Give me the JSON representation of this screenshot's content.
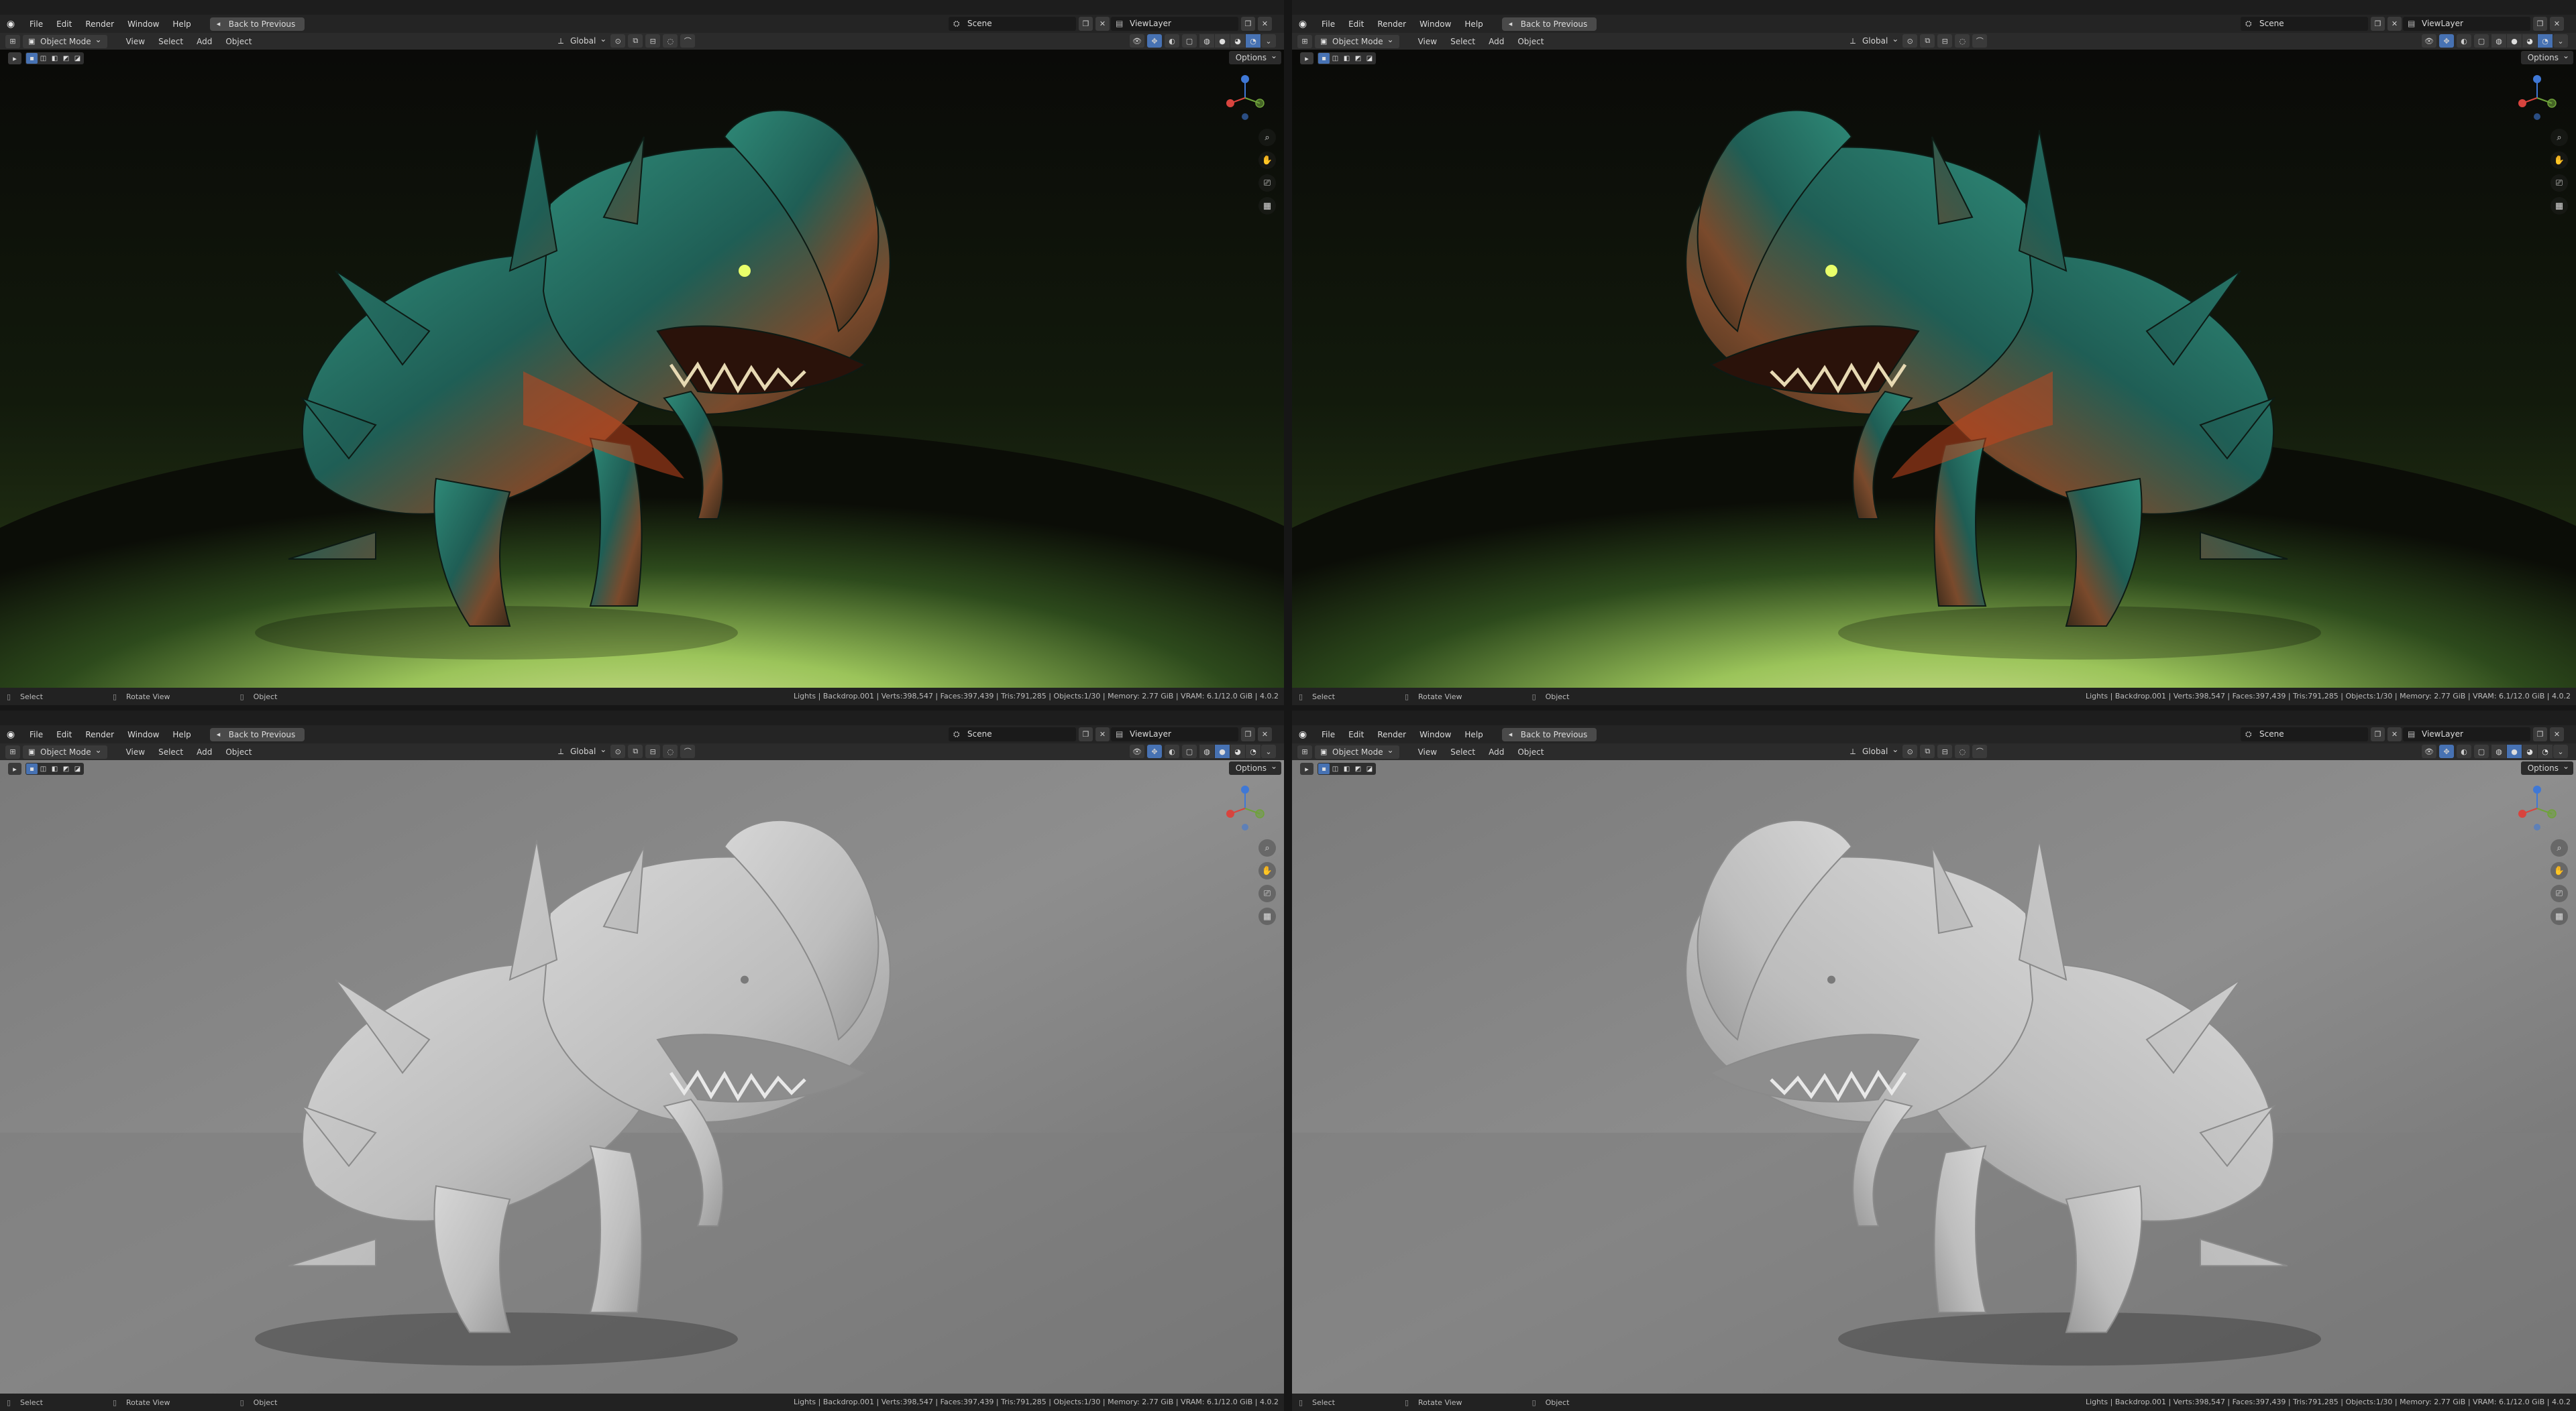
{
  "app": {
    "menus": [
      "File",
      "Edit",
      "Render",
      "Window",
      "Help"
    ],
    "back_label": "Back to Previous",
    "scene_label": "Scene",
    "view_layer_label": "ViewLayer"
  },
  "header": {
    "mode_label": "Object Mode",
    "menus": [
      "View",
      "Select",
      "Add",
      "Object"
    ],
    "orientation_label": "Global",
    "options_label": "Options"
  },
  "status": {
    "select_label": "Select",
    "rotate_label": "Rotate View",
    "object_label": "Object",
    "stats": "Lights | Backdrop.001 | Verts:398,547 | Faces:397,439 | Tris:791,285 | Objects:1/30 | Memory: 2.77 GiB | VRAM: 6.1/12.0 GiB | 4.0.2"
  },
  "icons": {
    "logo": "blender-logo-icon",
    "zoom": "zoom-icon",
    "pan": "hand-icon",
    "camera": "camera-icon",
    "grid": "ortho-grid-icon"
  },
  "colors": {
    "accent": "#4772b3",
    "axis_x": "#d8443e",
    "axis_y": "#6ea23a",
    "axis_z": "#3f78d6"
  }
}
